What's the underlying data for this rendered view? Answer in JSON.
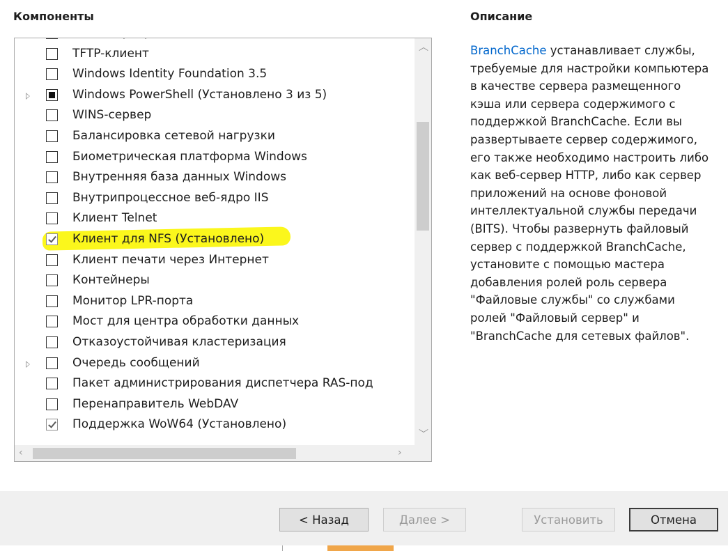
{
  "headers": {
    "components": "Компоненты",
    "description": "Описание"
  },
  "components": [
    {
      "label": "SMTP-сервер",
      "state": "unchecked",
      "expander": false
    },
    {
      "label": "TFTP-клиент",
      "state": "unchecked",
      "expander": false
    },
    {
      "label": "Windows Identity Foundation 3.5",
      "state": "unchecked",
      "expander": false
    },
    {
      "label": "Windows PowerShell (Установлено 3 из 5)",
      "state": "partial",
      "expander": true
    },
    {
      "label": "WINS-сервер",
      "state": "unchecked",
      "expander": false
    },
    {
      "label": "Балансировка сетевой нагрузки",
      "state": "unchecked",
      "expander": false
    },
    {
      "label": "Биометрическая платформа Windows",
      "state": "unchecked",
      "expander": false
    },
    {
      "label": "Внутренняя база данных Windows",
      "state": "unchecked",
      "expander": false
    },
    {
      "label": "Внутрипроцессное веб-ядро IIS",
      "state": "unchecked",
      "expander": false
    },
    {
      "label": "Клиент Telnet",
      "state": "unchecked",
      "expander": false
    },
    {
      "label": "Клиент для NFS (Установлено)",
      "state": "checked",
      "expander": false,
      "highlighted": true
    },
    {
      "label": "Клиент печати через Интернет",
      "state": "unchecked",
      "expander": false
    },
    {
      "label": "Контейнеры",
      "state": "unchecked",
      "expander": false
    },
    {
      "label": "Монитор LPR-порта",
      "state": "unchecked",
      "expander": false
    },
    {
      "label": "Мост для центра обработки данных",
      "state": "unchecked",
      "expander": false
    },
    {
      "label": "Отказоустойчивая кластеризация",
      "state": "unchecked",
      "expander": false
    },
    {
      "label": "Очередь сообщений",
      "state": "unchecked",
      "expander": true
    },
    {
      "label": "Пакет администрирования диспетчера RAS-под",
      "state": "unchecked",
      "expander": false
    },
    {
      "label": "Перенаправитель WebDAV",
      "state": "unchecked",
      "expander": false
    },
    {
      "label": "Поддержка WoW64 (Установлено)",
      "state": "checked",
      "expander": false
    }
  ],
  "description": {
    "link": "BranchCache",
    "text": " устанавливает службы, требуемые для настройки компьютера в качестве сервера размещенного кэша или сервера содержимого с поддержкой BranchCache. Если вы развертываете сервер содержимого, его также необходимо настроить либо как веб-сервер HTTP, либо как сервер приложений на основе фоновой интеллектуальной службы передачи (BITS). Чтобы развернуть файловый сервер с поддержкой BranchCache, установите с помощью мастера добавления ролей роль сервера \"Файловые службы\" со службами ролей \"Файловый сервер\" и \"BranchCache для сетевых файлов\"."
  },
  "buttons": {
    "back": "< Назад",
    "next": "Далее >",
    "install": "Установить",
    "cancel": "Отмена"
  },
  "icons": {
    "scroll_up": "chevron-up-icon",
    "scroll_down": "chevron-down-icon",
    "scroll_left": "chevron-left-icon",
    "scroll_right": "chevron-right-icon",
    "expander": "triangle-right-icon"
  },
  "colors": {
    "highlight": "#fbf71c",
    "link": "#0066cc",
    "footer": "#f0f0f0"
  }
}
